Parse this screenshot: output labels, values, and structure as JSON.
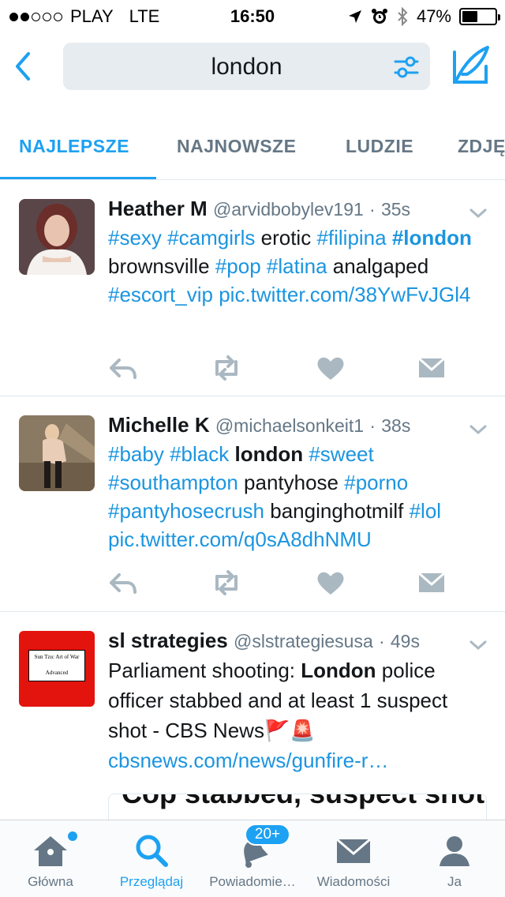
{
  "status_bar": {
    "carrier": "PLAY",
    "network": "LTE",
    "time": "16:50",
    "battery": "47%",
    "battery_level": 0.47
  },
  "search": {
    "query": "london"
  },
  "tabs": [
    {
      "label": "NAJLEPSZE",
      "active": true
    },
    {
      "label": "NAJNOWSZE",
      "active": false
    },
    {
      "label": "LUDZIE",
      "active": false
    },
    {
      "label": "ZDJĘ",
      "active": false
    }
  ],
  "tweets": [
    {
      "name": "Heather M",
      "handle": "@arvidbobylev191",
      "sep": "·",
      "time": "35s",
      "segments": [
        {
          "t": "tag",
          "v": "#sexy"
        },
        {
          "t": "text",
          "v": " "
        },
        {
          "t": "tag",
          "v": "#camgirls"
        },
        {
          "t": "text",
          "v": " erotic "
        },
        {
          "t": "tag",
          "v": "#filipina"
        },
        {
          "t": "text",
          "v": " "
        },
        {
          "t": "tagbold",
          "v": "#london"
        },
        {
          "t": "text",
          "v": " brownsville "
        },
        {
          "t": "tag",
          "v": "#pop"
        },
        {
          "t": "text",
          "v": " "
        },
        {
          "t": "tag",
          "v": "#latina"
        },
        {
          "t": "text",
          "v": " analgaped "
        },
        {
          "t": "tag",
          "v": "#escort_vip"
        },
        {
          "t": "text",
          "v": " "
        },
        {
          "t": "link",
          "v": "pic.twitter.com/38YwFvJGl4"
        }
      ]
    },
    {
      "name": "Michelle K",
      "handle": "@michaelsonkeit1",
      "sep": "·",
      "time": "38s",
      "segments": [
        {
          "t": "tag",
          "v": "#baby"
        },
        {
          "t": "text",
          "v": " "
        },
        {
          "t": "tag",
          "v": "#black"
        },
        {
          "t": "text",
          "v": " "
        },
        {
          "t": "bold",
          "v": "london"
        },
        {
          "t": "text",
          "v": " "
        },
        {
          "t": "tag",
          "v": "#sweet"
        },
        {
          "t": "text",
          "v": " "
        },
        {
          "t": "tag",
          "v": "#southampton"
        },
        {
          "t": "text",
          "v": " pantyhose "
        },
        {
          "t": "tag",
          "v": "#porno"
        },
        {
          "t": "text",
          "v": " "
        },
        {
          "t": "tag",
          "v": "#pantyhosecrush"
        },
        {
          "t": "text",
          "v": " banginghotmilf "
        },
        {
          "t": "tag",
          "v": "#lol"
        },
        {
          "t": "text",
          "v": " "
        },
        {
          "t": "link",
          "v": "pic.twitter.com/q0sA8dhNMU"
        }
      ]
    },
    {
      "name": "sl strategies",
      "handle": "@slstrategiesusa",
      "sep": "·",
      "time": "49s",
      "avatar_text_1": "Sun Tzu: Art of War",
      "avatar_text_2": "Advanced",
      "segments": [
        {
          "t": "text",
          "v": "Parliament shooting: "
        },
        {
          "t": "bold",
          "v": "London"
        },
        {
          "t": "text",
          "v": " police officer stabbed and at least 1 suspect shot - CBS News🚩🚨 "
        },
        {
          "t": "link",
          "v": "cbsnews.com/news/gunfire-r…"
        }
      ],
      "card_headline": "Cop stabbed, suspect shot inside U.K. Parliament"
    }
  ],
  "tabbar": [
    {
      "label": "Główna",
      "icon": "home-icon",
      "active": false
    },
    {
      "label": "Przeglądaj",
      "icon": "search-icon",
      "active": true
    },
    {
      "label": "Powiadomie…",
      "icon": "bell-icon",
      "active": false,
      "badge": "20+"
    },
    {
      "label": "Wiadomości",
      "icon": "envelope-icon",
      "active": false
    },
    {
      "label": "Ja",
      "icon": "person-icon",
      "active": false
    }
  ],
  "colors": {
    "accent": "#1da1f2",
    "link": "#1b95e0",
    "muted": "#657786",
    "icon_gray": "#aab8c2"
  }
}
